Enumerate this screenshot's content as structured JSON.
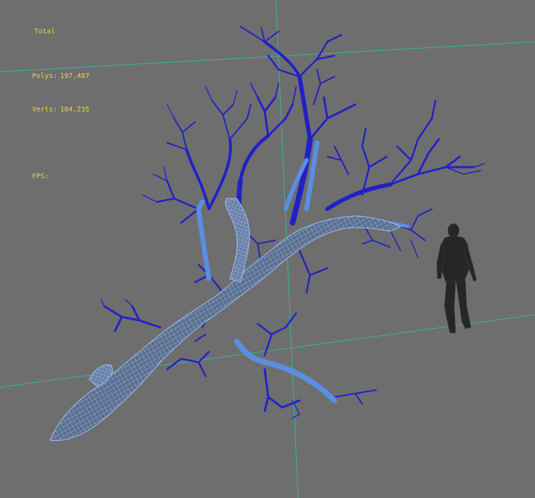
{
  "viewport": {
    "background": "#6e6e6e",
    "grid_color": "#2fb8a8",
    "trunk_wire_color": "#8fb4ee",
    "branch_color": "#2121c8",
    "branch_highlight": "#5a8fe0",
    "figure_color": "#262626"
  },
  "hud": {
    "header": "Total",
    "polys_label": "Polys:",
    "polys_value": "197,487",
    "verts_label": "Verts:",
    "verts_value": "184,235",
    "fps_label": "FPS:",
    "fps_value": ""
  },
  "scene": {
    "objects": [
      "tree-wireframe",
      "human-scale-figure"
    ]
  }
}
